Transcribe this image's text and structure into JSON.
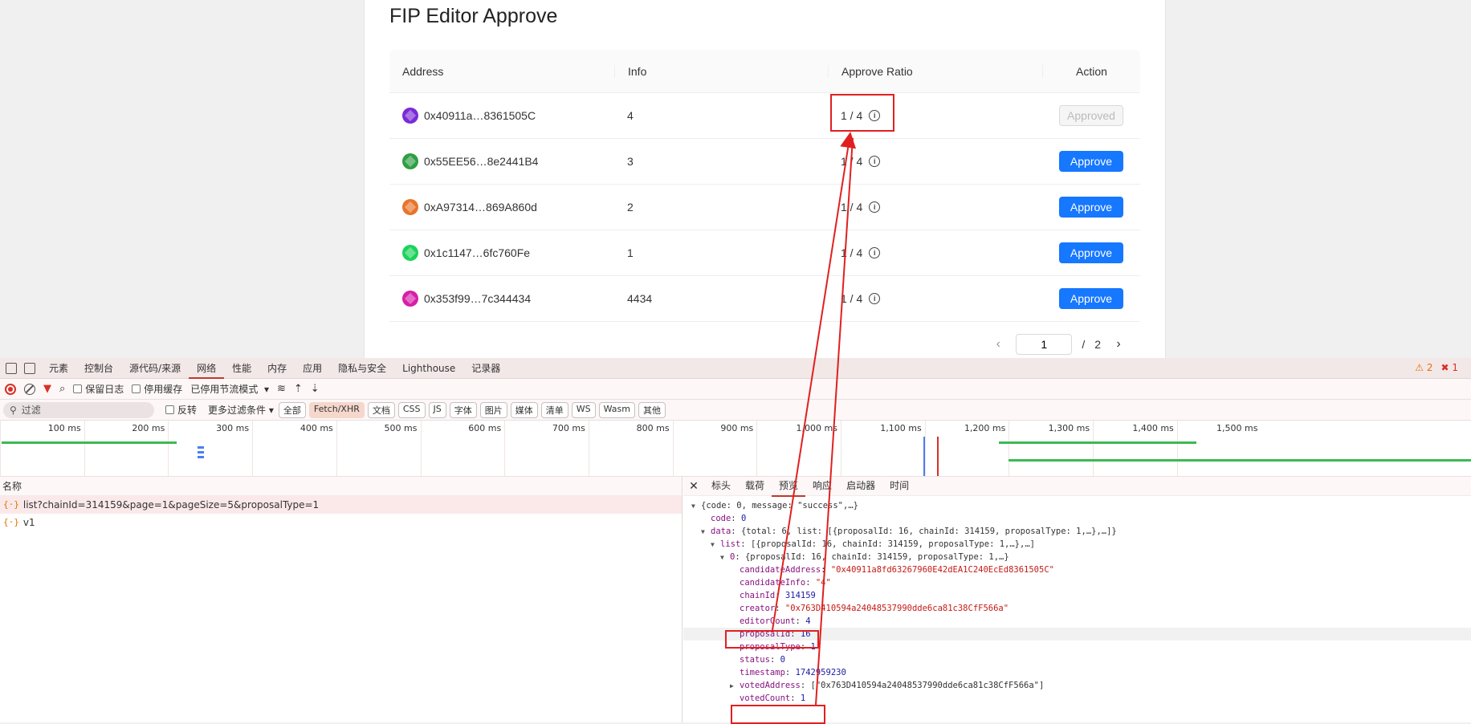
{
  "app": {
    "title": "FIP Editor Approve",
    "columns": [
      "Address",
      "Info",
      "Approve Ratio",
      "Action"
    ],
    "rows": [
      {
        "address": "0x40911a…8361505C",
        "info": "4",
        "ratio": "1 / 4",
        "action": "Approved",
        "approved": true,
        "avatar_color": "#7a2bd6"
      },
      {
        "address": "0x55EE56…8e2441B4",
        "info": "3",
        "ratio": "1 / 4",
        "action": "Approve",
        "approved": false,
        "avatar_color": "#2f9e44"
      },
      {
        "address": "0xA97314…869A860d",
        "info": "2",
        "ratio": "1 / 4",
        "action": "Approve",
        "approved": false,
        "avatar_color": "#e8742b"
      },
      {
        "address": "0x1c1147…6fc760Fe",
        "info": "1",
        "ratio": "1 / 4",
        "action": "Approve",
        "approved": false,
        "avatar_color": "#1bd35a"
      },
      {
        "address": "0x353f99…7c344434",
        "info": "4434",
        "ratio": "1 / 4",
        "action": "Approve",
        "approved": false,
        "avatar_color": "#d61fa8"
      }
    ],
    "pagination": {
      "current": "1",
      "separator": "/",
      "total": "2"
    }
  },
  "devtools": {
    "tabs": [
      "元素",
      "控制台",
      "源代码/来源",
      "网络",
      "性能",
      "内存",
      "应用",
      "隐私与安全",
      "Lighthouse",
      "记录器"
    ],
    "active_tab": "网络",
    "warnings": "2",
    "errors": "1",
    "toolbar": {
      "preserve_log": "保留日志",
      "disable_cache": "停用缓存",
      "throttle": "已停用节流模式"
    },
    "filter": {
      "placeholder": "过滤",
      "invert": "反转",
      "more": "更多过滤条件",
      "types": [
        "全部",
        "Fetch/XHR",
        "文档",
        "CSS",
        "JS",
        "字体",
        "图片",
        "媒体",
        "清单",
        "WS",
        "Wasm",
        "其他"
      ],
      "active_type": "Fetch/XHR"
    },
    "timeline_ticks": [
      "100 ms",
      "200 ms",
      "300 ms",
      "400 ms",
      "500 ms",
      "600 ms",
      "700 ms",
      "800 ms",
      "900 ms",
      "1,000 ms",
      "1,100 ms",
      "1,200 ms",
      "1,300 ms",
      "1,400 ms",
      "1,500 ms"
    ],
    "requests_header": "名称",
    "requests": [
      {
        "name": "list?chainId=314159&page=1&pageSize=5&proposalType=1",
        "selected": true
      },
      {
        "name": "v1",
        "selected": false
      }
    ],
    "preview_tabs": [
      "标头",
      "载荷",
      "预览",
      "响应",
      "启动器",
      "时间"
    ],
    "preview_active": "预览",
    "json_lines": [
      {
        "indent": 0,
        "arrow": "▼",
        "text": "{code: 0, message: \"success\",…}",
        "cls": "p"
      },
      {
        "indent": 1,
        "key": "code",
        "val": "0",
        "vcls": "n"
      },
      {
        "indent": 1,
        "arrow": "▼",
        "key": "data",
        "val": "{total: 6, list: [{proposalId: 16, chainId: 314159, proposalType: 1,…},…]}",
        "vcls": "p"
      },
      {
        "indent": 2,
        "arrow": "▼",
        "key": "list",
        "val": "[{proposalId: 16, chainId: 314159, proposalType: 1,…},…]",
        "vcls": "p"
      },
      {
        "indent": 3,
        "arrow": "▼",
        "key": "0",
        "val": "{proposalId: 16, chainId: 314159, proposalType: 1,…}",
        "vcls": "p"
      },
      {
        "indent": 4,
        "key": "candidateAddress",
        "val": "\"0x40911a8fd63267960E42dEA1C240EcEd8361505C\"",
        "vcls": "s"
      },
      {
        "indent": 4,
        "key": "candidateInfo",
        "val": "\"4\"",
        "vcls": "s"
      },
      {
        "indent": 4,
        "key": "chainId",
        "val": "314159",
        "vcls": "n"
      },
      {
        "indent": 4,
        "key": "creator",
        "val": "\"0x763D410594a24048537990dde6ca81c38CfF566a\"",
        "vcls": "s"
      },
      {
        "indent": 4,
        "key": "editorCount",
        "val": "4",
        "vcls": "n"
      },
      {
        "indent": 4,
        "key": "proposalId",
        "val": "16",
        "vcls": "n",
        "hl": true
      },
      {
        "indent": 4,
        "key": "proposalType",
        "val": "1",
        "vcls": "n"
      },
      {
        "indent": 4,
        "key": "status",
        "val": "0",
        "vcls": "n"
      },
      {
        "indent": 4,
        "key": "timestamp",
        "val": "1742959230",
        "vcls": "n"
      },
      {
        "indent": 4,
        "arrow": "▶",
        "key": "votedAddress",
        "val": "[\"0x763D410594a24048537990dde6ca81c38CfF566a\"]",
        "vcls": "p"
      },
      {
        "indent": 4,
        "key": "votedCount",
        "val": "1",
        "vcls": "n"
      }
    ]
  }
}
